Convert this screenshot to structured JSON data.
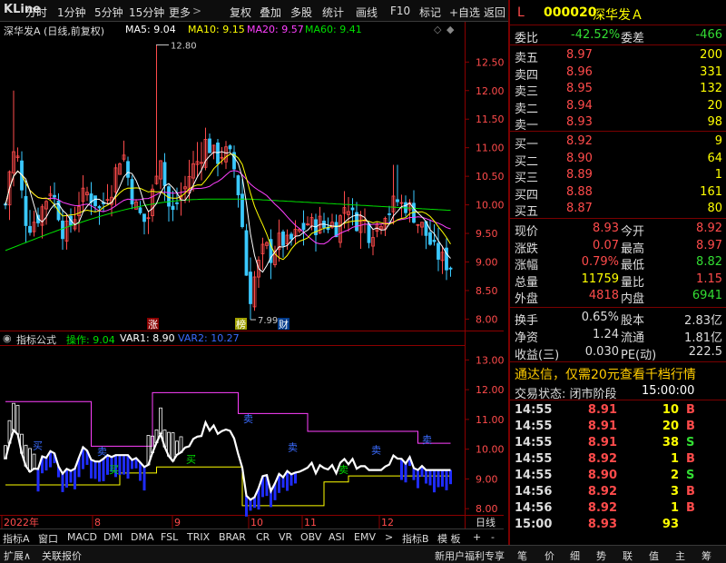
{
  "toolbar": {
    "logo": "KLine",
    "left_items": [
      "分时",
      "1分钟",
      "5分钟",
      "15分钟",
      "更多"
    ],
    "right_items": [
      "复权",
      "叠加",
      "多股",
      "统计",
      "画线",
      "F10",
      "标记",
      "+自选",
      "返回"
    ]
  },
  "chart_header": {
    "title": "深华发A (日线,前复权)",
    "ma5": "MA5: 9.04",
    "ma10": "MA10: 9.15",
    "ma20": "MA20: 9.57",
    "ma60": "MA60: 9.41"
  },
  "price_axis": [
    "12.50",
    "12.00",
    "11.50",
    "11.00",
    "10.50",
    "10.00",
    "9.50",
    "9.00",
    "8.50",
    "8.00"
  ],
  "annotations": {
    "high": "12.80",
    "low": "7.99",
    "zhang": "涨",
    "bang": "榜",
    "cai": "财"
  },
  "indicator_header": {
    "name": "指标公式",
    "op": "操作: 9.04",
    "var1": "VAR1: 8.90",
    "var2": "VAR2: 10.27"
  },
  "indicator_axis": [
    "13.00",
    "12.00",
    "11.00",
    "10.00",
    "9.00",
    "8.00"
  ],
  "indicator_labels": [
    "买",
    "买",
    "卖",
    "买",
    "卖",
    "卖",
    "卖",
    "卖",
    "卖"
  ],
  "date_axis": [
    "2022年",
    "8",
    "9",
    "10",
    "11",
    "12"
  ],
  "period": "日线",
  "bottom_tabs": [
    "指标A",
    "窗口",
    "MACD",
    "DMI",
    "DMA",
    "FSL",
    "TRIX",
    "BRAR",
    "CR",
    "VR",
    "OBV",
    "ASI",
    "EMV",
    ">",
    "指标B",
    "模 板",
    "+",
    "-"
  ],
  "status_bar": [
    "扩展∧",
    "关联报价"
  ],
  "status_right": "新用户福利专享",
  "status_icons": [
    "笔",
    "价",
    "细",
    "势",
    "联",
    "值",
    "主",
    "筹"
  ],
  "stock": {
    "flag": "L",
    "code": "000020",
    "name": "深华发Ａ"
  },
  "ratio": {
    "label1": "委比",
    "val1": "-42.52%",
    "label2": "委差",
    "val2": "-466"
  },
  "asks": [
    {
      "label": "卖五",
      "price": "8.97",
      "vol": "200"
    },
    {
      "label": "卖四",
      "price": "8.96",
      "vol": "331"
    },
    {
      "label": "卖三",
      "price": "8.95",
      "vol": "132"
    },
    {
      "label": "卖二",
      "price": "8.94",
      "vol": "20"
    },
    {
      "label": "卖一",
      "price": "8.93",
      "vol": "98"
    }
  ],
  "bids": [
    {
      "label": "买一",
      "price": "8.92",
      "vol": "9"
    },
    {
      "label": "买二",
      "price": "8.90",
      "vol": "64"
    },
    {
      "label": "买三",
      "price": "8.89",
      "vol": "1"
    },
    {
      "label": "买四",
      "price": "8.88",
      "vol": "161"
    },
    {
      "label": "买五",
      "price": "8.87",
      "vol": "80"
    }
  ],
  "quote": [
    {
      "l1": "现价",
      "v1": "8.93",
      "c1": "#ff4b4b",
      "l2": "今开",
      "v2": "8.92",
      "c2": "#ff4b4b"
    },
    {
      "l1": "涨跌",
      "v1": "0.07",
      "c1": "#ff4b4b",
      "l2": "最高",
      "v2": "8.97",
      "c2": "#ff4b4b"
    },
    {
      "l1": "涨幅",
      "v1": "0.79%",
      "c1": "#ff4b4b",
      "l2": "最低",
      "v2": "8.82",
      "c2": "#33dd33"
    },
    {
      "l1": "总量",
      "v1": "11759",
      "c1": "#ffff00",
      "l2": "量比",
      "v2": "1.15",
      "c2": "#ff4b4b"
    },
    {
      "l1": "外盘",
      "v1": "4818",
      "c1": "#ff4b4b",
      "l2": "内盘",
      "v2": "6941",
      "c2": "#33dd33"
    }
  ],
  "fundamentals": [
    {
      "l1": "换手",
      "v1": "0.65%",
      "l2": "股本",
      "v2": "2.83亿"
    },
    {
      "l1": "净资",
      "v1": "1.24",
      "l2": "流通",
      "v2": "1.81亿"
    },
    {
      "l1": "收益(三)",
      "v1": "0.030",
      "l2": "PE(动)",
      "v2": "222.5"
    }
  ],
  "promo": "通达信，仅需20元查看千档行情",
  "trade_status": {
    "label": "交易状态: 闭市阶段",
    "time": "15:00:00"
  },
  "ticks": [
    {
      "t": "14:55",
      "p": "8.91",
      "pc": "#ff4b4b",
      "v": "10",
      "vc": "#ffff00",
      "s": "B",
      "sc": "#ff4b4b"
    },
    {
      "t": "14:55",
      "p": "8.91",
      "pc": "#ff4b4b",
      "v": "20",
      "vc": "#ffff00",
      "s": "B",
      "sc": "#ff4b4b"
    },
    {
      "t": "14:55",
      "p": "8.91",
      "pc": "#ff4b4b",
      "v": "38",
      "vc": "#ffff00",
      "s": "S",
      "sc": "#33dd33"
    },
    {
      "t": "14:55",
      "p": "8.92",
      "pc": "#ff4b4b",
      "v": "1",
      "vc": "#ffff00",
      "s": "B",
      "sc": "#ff4b4b"
    },
    {
      "t": "14:55",
      "p": "8.90",
      "pc": "#ff4b4b",
      "v": "2",
      "vc": "#ffff00",
      "s": "S",
      "sc": "#33dd33"
    },
    {
      "t": "14:56",
      "p": "8.92",
      "pc": "#ff4b4b",
      "v": "3",
      "vc": "#ffff00",
      "s": "B",
      "sc": "#ff4b4b"
    },
    {
      "t": "14:56",
      "p": "8.92",
      "pc": "#ff4b4b",
      "v": "1",
      "vc": "#ffff00",
      "s": "B",
      "sc": "#ff4b4b"
    },
    {
      "t": "15:00",
      "p": "8.93",
      "pc": "#ff4b4b",
      "v": "93",
      "vc": "#ffff00",
      "s": "",
      "sc": "#ff4b4b"
    }
  ],
  "colors": {
    "up": "#ff4b4b",
    "down": "#3ac9ff",
    "ma5": "#ffffff",
    "ma10": "#ffff00",
    "ma20": "#ff40ff",
    "ma60": "#00e000",
    "panel_border": "#7a0000"
  }
}
